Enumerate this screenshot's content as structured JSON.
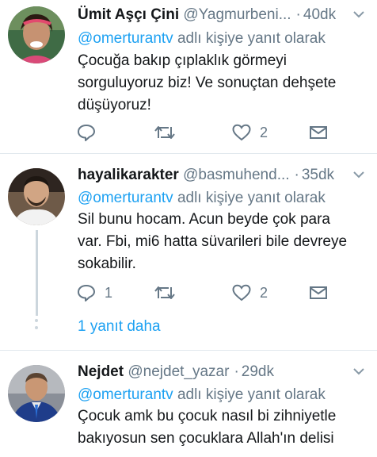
{
  "tweets": [
    {
      "name": "Ümit Aşçı Çini",
      "handle": "@Yagmurbeni...",
      "time": "40dk",
      "reply_prefix": "@omerturantv",
      "reply_suffix": " adlı kişiye yanıt olarak",
      "lines": [
        "Çocuğa bakıp çıplaklık görmeyi",
        "sorguluyoruz biz! Ve sonuçtan dehşete",
        "düşüyoruz!"
      ],
      "reply_count": "",
      "retweet_count": "",
      "like_count": "2"
    },
    {
      "name": "hayalikarakter",
      "handle": "@basmuhend...",
      "time": "35dk",
      "reply_prefix": "@omerturantv",
      "reply_suffix": " adlı kişiye yanıt olarak",
      "lines": [
        "Sil bunu hocam. Acun beyde çok para",
        "var. Fbi, mi6 hatta süvarileri bile devreye",
        "sokabilir."
      ],
      "reply_count": "1",
      "retweet_count": "",
      "like_count": "2",
      "more_replies": "1 yanıt daha"
    },
    {
      "name": "Nejdet",
      "handle": "@nejdet_yazar",
      "time": "29dk",
      "reply_prefix": "@omerturantv",
      "reply_suffix": " adlı kişiye yanıt olarak",
      "lines": [
        "Çocuk amk bu çocuk nasıl bi zihniyetle",
        "bakıyosun sen çocuklara Allah'ın delisi"
      ]
    }
  ],
  "icons": {
    "reply": "reply-icon",
    "retweet": "retweet-icon",
    "like": "heart-icon",
    "dm": "envelope-icon",
    "more": "chevron-down-icon"
  },
  "colors": {
    "accent": "#1da1f2",
    "secondary_text": "#657786",
    "divider": "#e1e8ed"
  }
}
